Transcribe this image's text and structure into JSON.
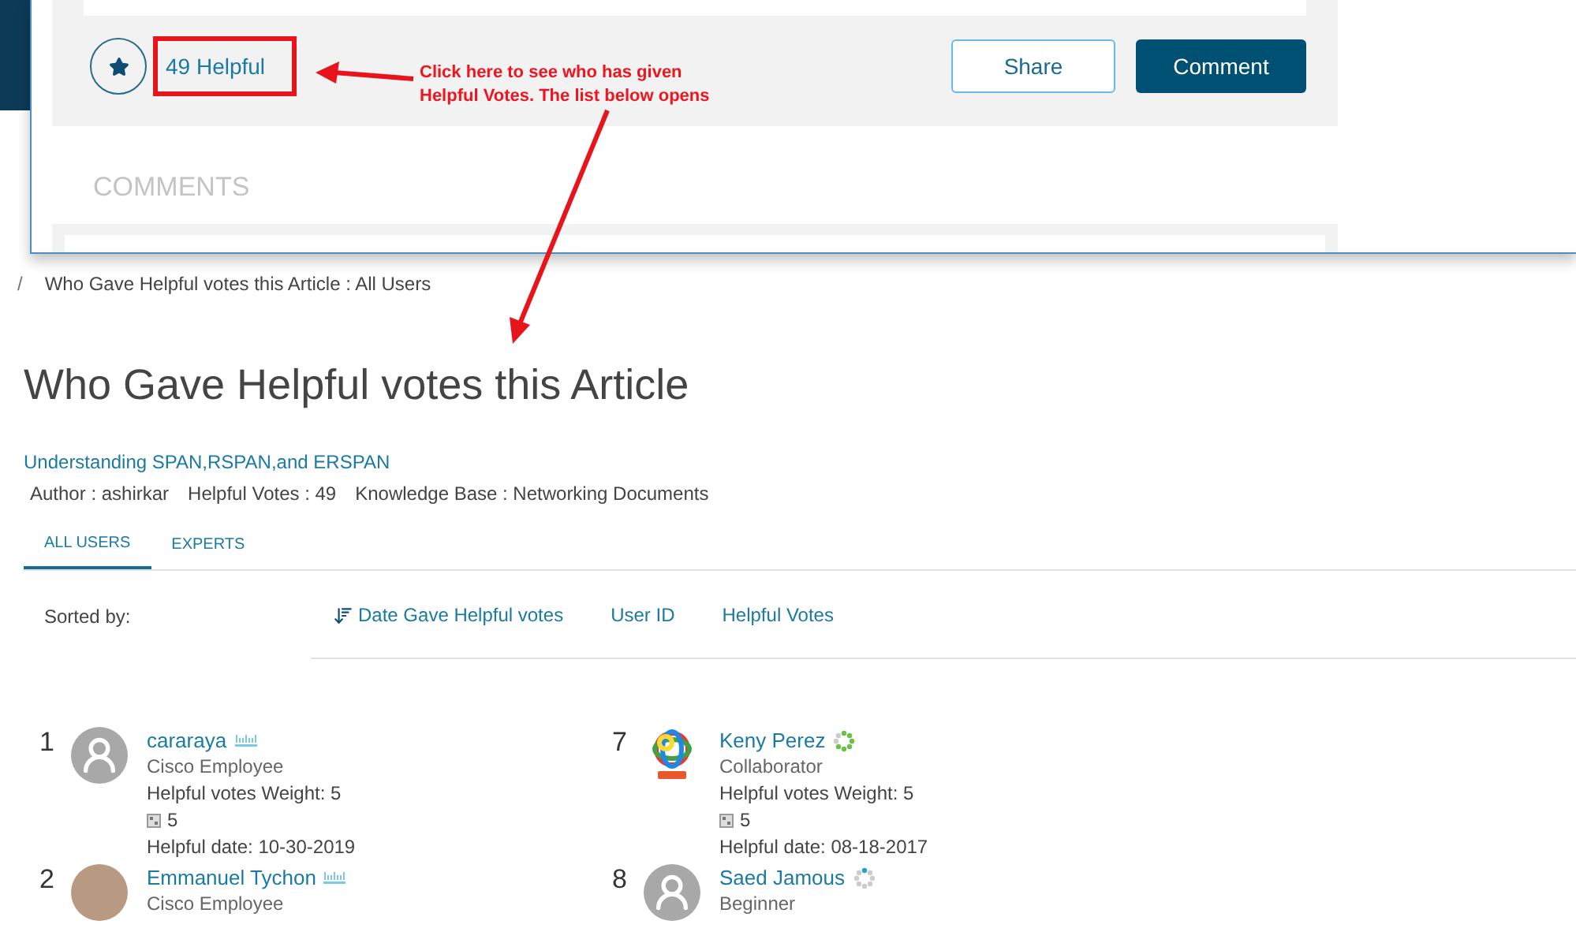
{
  "overlay": {
    "helpful_count": "49 Helpful",
    "buttons": [
      {
        "label": "Share",
        "kind": "outline"
      },
      {
        "label": "Comment",
        "kind": "primary"
      }
    ],
    "section_title": "COMMENTS"
  },
  "annotation": {
    "lines": [
      "Click here to see who has given",
      "Helpful Votes. The list below opens"
    ]
  },
  "breadcrumb": {
    "separator": "/",
    "current": "Who Gave Helpful votes this Article : All Users"
  },
  "title": "Who Gave Helpful votes this Article",
  "article": {
    "link": "Understanding SPAN,RSPAN,and ERSPAN",
    "meta": [
      "Author : ashirkar",
      "Helpful Votes : 49",
      "Knowledge Base : Networking Documents"
    ]
  },
  "tabs": [
    {
      "label": "ALL USERS",
      "selected": true
    },
    {
      "label": "EXPERTS",
      "selected": false
    }
  ],
  "sort": {
    "label": "Sorted by:",
    "options": [
      {
        "label": "Date Gave Helpful votes",
        "selected": true
      },
      {
        "label": "User ID",
        "selected": false
      },
      {
        "label": "Helpful Votes",
        "selected": false
      }
    ]
  },
  "columns": [
    [
      {
        "rank": "1",
        "name": "cararaya",
        "avatar": {
          "kind": "default"
        },
        "badge": {
          "kind": "cisco"
        },
        "role": "Cisco Employee",
        "weight": "Helpful votes Weight: 5",
        "score": "5",
        "date": "Helpful date: 10-30-2019"
      },
      {
        "rank": "2",
        "name": "Emmanuel Tychon",
        "avatar": {
          "kind": "photo"
        },
        "badge": {
          "kind": "cisco"
        },
        "role": "Cisco Employee"
      }
    ],
    [
      {
        "rank": "7",
        "name": "Keny Perez",
        "avatar": {
          "kind": "logo"
        },
        "badge": {
          "kind": "ring-green"
        },
        "role": "Collaborator",
        "weight": "Helpful votes Weight: 5",
        "score": "5",
        "date": "Helpful date: 08-18-2017"
      },
      {
        "rank": "8",
        "name": "Saed Jamous",
        "avatar": {
          "kind": "default"
        },
        "badge": {
          "kind": "ring-blue"
        },
        "role": "Beginner"
      }
    ]
  ]
}
